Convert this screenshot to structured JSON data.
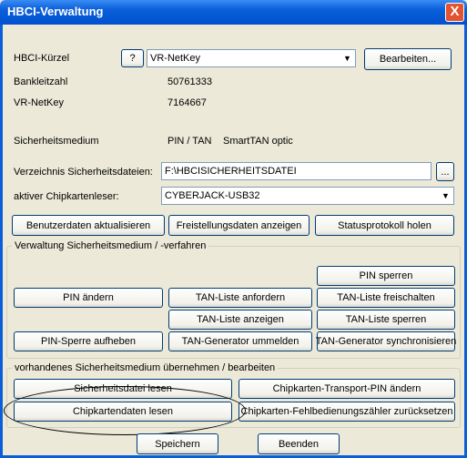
{
  "window": {
    "title": "HBCI-Verwaltung",
    "close_glyph": "X"
  },
  "hbci": {
    "label": "HBCI-Kürzel",
    "help_label": "?",
    "selected": "VR-NetKey",
    "edit_label": "Bearbeiten..."
  },
  "info": {
    "blz_label": "Bankleitzahl",
    "blz_value": "50761333",
    "netkey_label": "VR-NetKey",
    "netkey_value": "7164667",
    "medium_label": "Sicherheitsmedium",
    "medium_value": "PIN / TAN",
    "medium_extra": "SmartTAN optic"
  },
  "files": {
    "dir_label": "Verzeichnis Sicherheitsdateien:",
    "dir_value": "F:\\HBCISICHERHEITSDATEI",
    "browse_label": "...",
    "reader_label": "aktiver Chipkartenleser:",
    "reader_value": "CYBERJACK-USB32"
  },
  "top_buttons": {
    "update_user": "Benutzerdaten aktualisieren",
    "show_exemption": "Freistellungsdaten anzeigen",
    "fetch_status": "Statusprotokoll holen"
  },
  "group1": {
    "title": "Verwaltung Sicherheitsmedium / -verfahren",
    "pin_lock": "PIN sperren",
    "pin_change": "PIN ändern",
    "tan_request": "TAN-Liste anfordern",
    "tan_unlock": "TAN-Liste freischalten",
    "tan_show": "TAN-Liste anzeigen",
    "tan_lock": "TAN-Liste sperren",
    "pin_unlock": "PIN-Sperre aufheben",
    "gen_reregister": "TAN-Generator ummelden",
    "gen_sync": "TAN-Generator synchronisieren"
  },
  "group2": {
    "title": "vorhandenes Sicherheitsmedium übernehmen / bearbeiten",
    "read_file": "Sicherheitsdatei lesen",
    "change_transport_pin": "Chipkarten-Transport-PIN ändern",
    "read_card": "Chipkartendaten lesen",
    "reset_counter": "Chipkarten-Fehlbedienungszähler zurücksetzen"
  },
  "bottom": {
    "save": "Speichern",
    "close": "Beenden"
  }
}
